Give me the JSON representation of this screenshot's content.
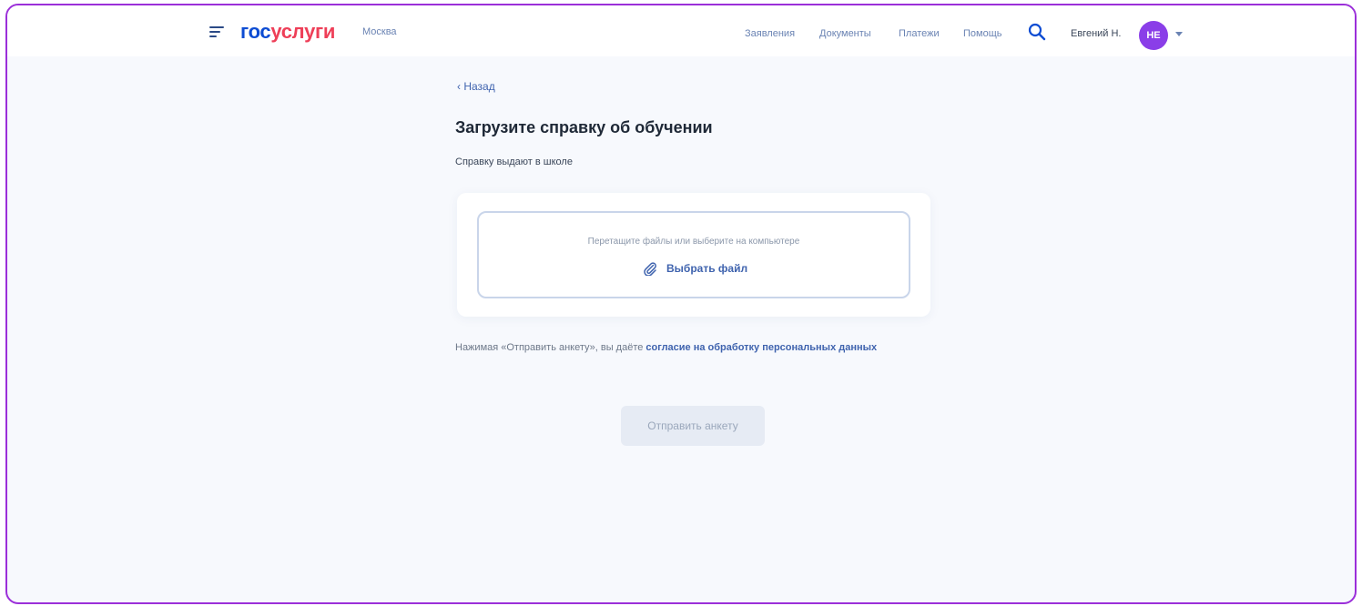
{
  "header": {
    "logo_part1": "гос",
    "logo_part2": "услуги",
    "city": "Москва",
    "nav": [
      "Заявления",
      "Документы",
      "Платежи",
      "Помощь"
    ],
    "user_name": "Евгений Н.",
    "avatar_initials": "НЕ"
  },
  "page": {
    "back_label": "Назад",
    "title": "Загрузите справку об обучении",
    "subtitle": "Справку выдают в школе"
  },
  "upload": {
    "hint": "Перетащите файлы или выберите на компьютере",
    "choose_label": "Выбрать файл"
  },
  "consent": {
    "text": "Нажимая «Отправить анкету», вы даёте ",
    "link": "согласие на обработку персональных данных"
  },
  "submit_label": "Отправить анкету",
  "colors": {
    "frame_border": "#9b2fd9",
    "brand_blue": "#0d4cd3",
    "brand_red": "#ee3f58",
    "avatar": "#8a3ee8",
    "link": "#3f63ae"
  }
}
